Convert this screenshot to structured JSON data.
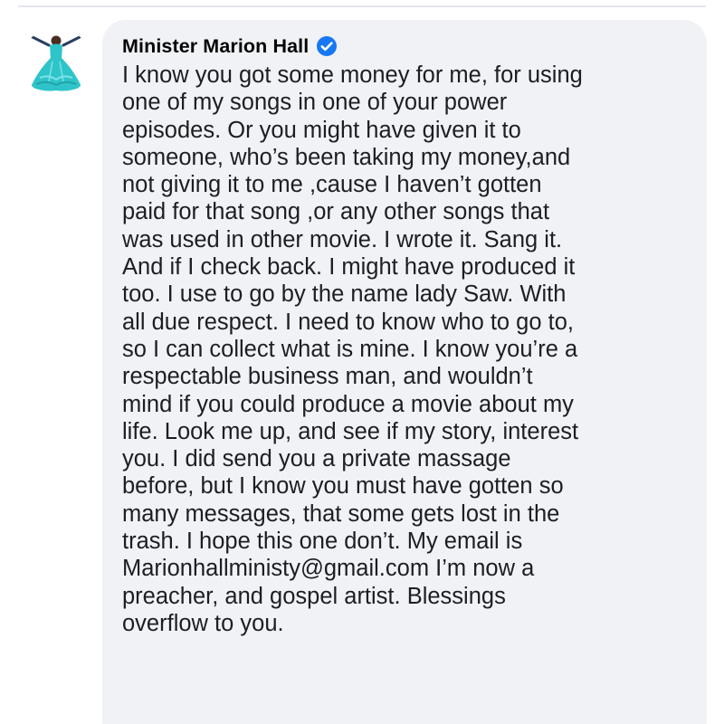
{
  "comment": {
    "author": "Minister Marion Hall",
    "verified": true,
    "lines": [
      "I know you got some money for me, for using",
      "one of my songs in one of your power",
      "episodes. Or you might have given it to",
      "someone, who’s been taking my money,and",
      "not giving it to me ,cause I haven’t gotten",
      "paid for that song ,or any other songs that",
      "was used in other movie. I wrote it. Sang it.",
      "And if I check back. I might have produced it",
      "too. I use to go by the name lady Saw. With",
      "all due respect. I need to know who to go to,",
      "so I can collect what is mine. I know you’re a",
      "respectable business man, and wouldn’t",
      "mind if you could produce a movie about my",
      "life. Look me up, and see if my story, interest",
      "you. I did send you a private massage",
      "before, but I know you must have gotten so",
      "many messages, that some gets lost in the",
      "trash. I hope this one don’t. My email is",
      "Marionhallministy@gmail.com  I’m now a",
      "preacher, and gospel artist. Blessings",
      "overflow to you."
    ]
  },
  "colors": {
    "bubble_bg": "#f0f2f5",
    "text": "#1c1e21",
    "verified_blue": "#1877f2",
    "avatar_dress": "#2ec4c9"
  },
  "icons": {
    "verified": "verified-check-icon",
    "avatar": "profile-avatar"
  }
}
